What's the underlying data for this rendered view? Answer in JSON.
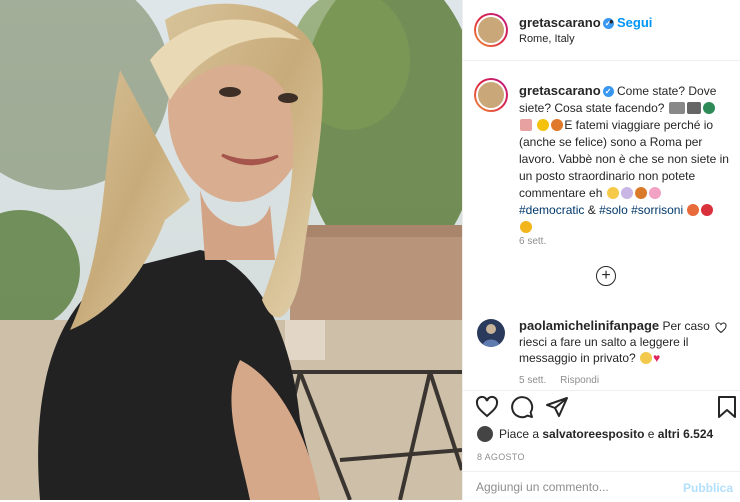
{
  "post": {
    "username": "gretascarano",
    "follow_label": "Segui",
    "separator": "•",
    "location": "Rome, Italy"
  },
  "caption": {
    "username": "gretascarano",
    "line1": "Come state? Dove siete? Cosa state facendo?",
    "line2": "E fatemi viaggiare perché io (anche se felice) sono a Roma per lavoro. Vabbè non è che se non siete in un posto straordinario non potete commentare eh",
    "tag1": "#democratic",
    "amp": "&",
    "tag2": "#solo",
    "tag3": "#sorrisoni",
    "time": "6 sett."
  },
  "comment": {
    "username": "paolamichelinifanpage",
    "text": "Per caso riesci a fare un salto a leggere il messaggio in privato?",
    "time": "5 sett.",
    "reply_label": "Rispondi"
  },
  "likes": {
    "prefix": "Piace a",
    "user": "salvatoreesposito",
    "middle": "e",
    "count": "altri 6.524"
  },
  "date": "8 AGOSTO",
  "add_comment": {
    "placeholder": "Aggiungi un commento...",
    "publish_label": "Pubblica"
  },
  "colors": {
    "link": "#0095f6",
    "hashtag": "#00376b",
    "muted": "#8e8e8e",
    "verified": "#3897f0"
  },
  "icons": [
    "verified-icon",
    "heart-icon",
    "comment-icon",
    "share-icon",
    "bookmark-icon",
    "add-comment-icon"
  ]
}
